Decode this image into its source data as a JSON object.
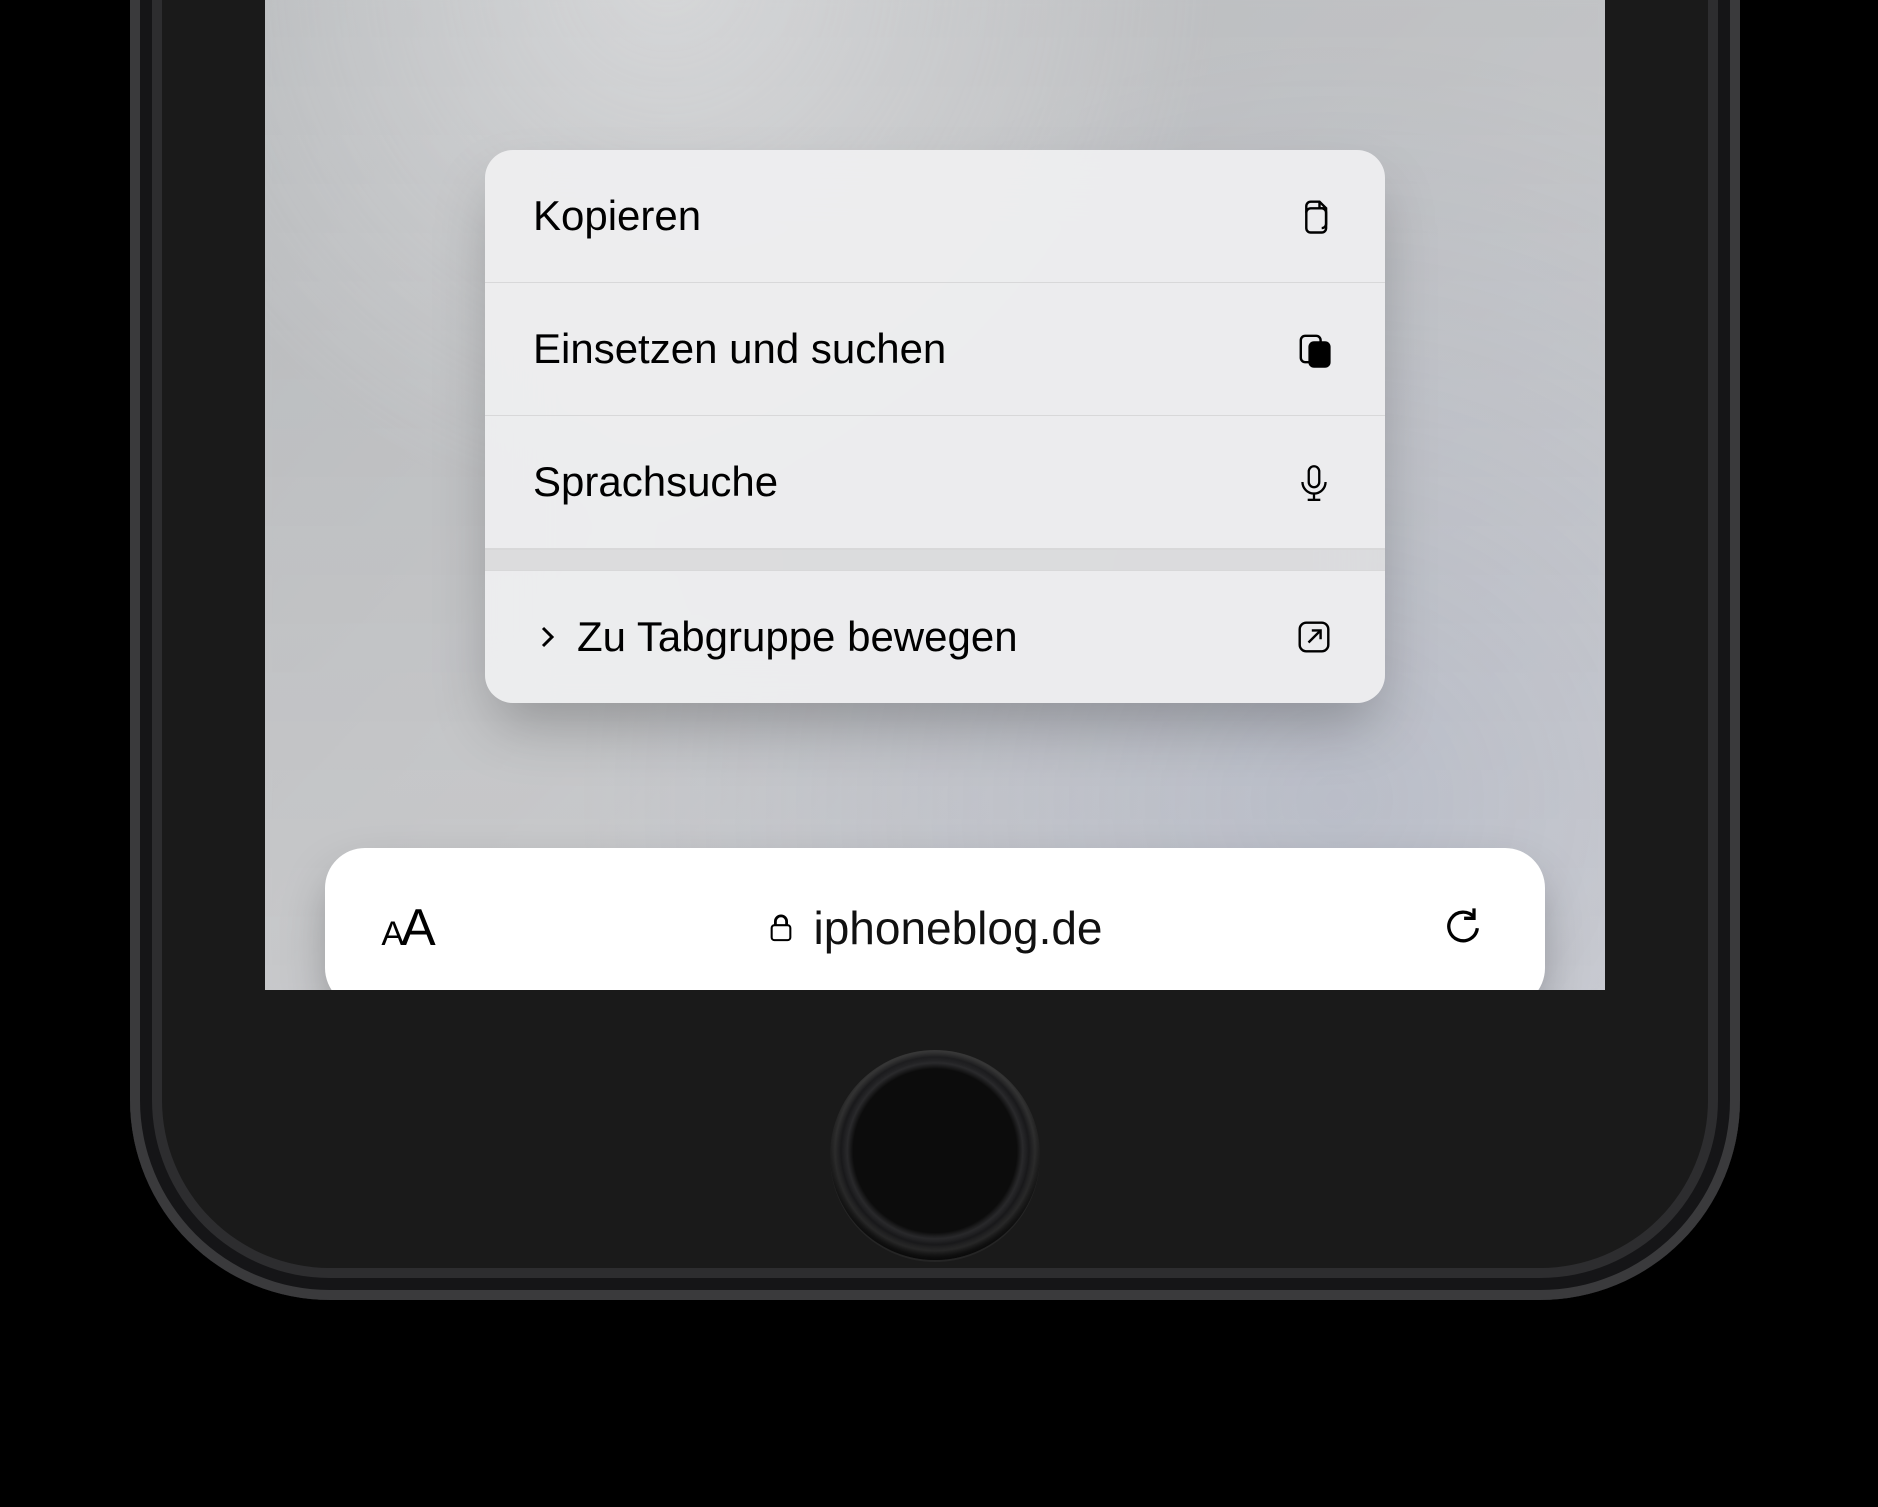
{
  "context_menu": {
    "items": [
      {
        "label": "Kopieren",
        "icon": "copy-icon"
      },
      {
        "label": "Einsetzen und suchen",
        "icon": "paste-search-icon"
      },
      {
        "label": "Sprachsuche",
        "icon": "microphone-icon"
      }
    ],
    "submenu": {
      "label": "Zu Tabgruppe bewegen",
      "icon": "move-to-tabgroup-icon"
    }
  },
  "address_bar": {
    "domain": "iphoneblog.de",
    "left_button": "reader-text-size",
    "right_button": "reload"
  }
}
